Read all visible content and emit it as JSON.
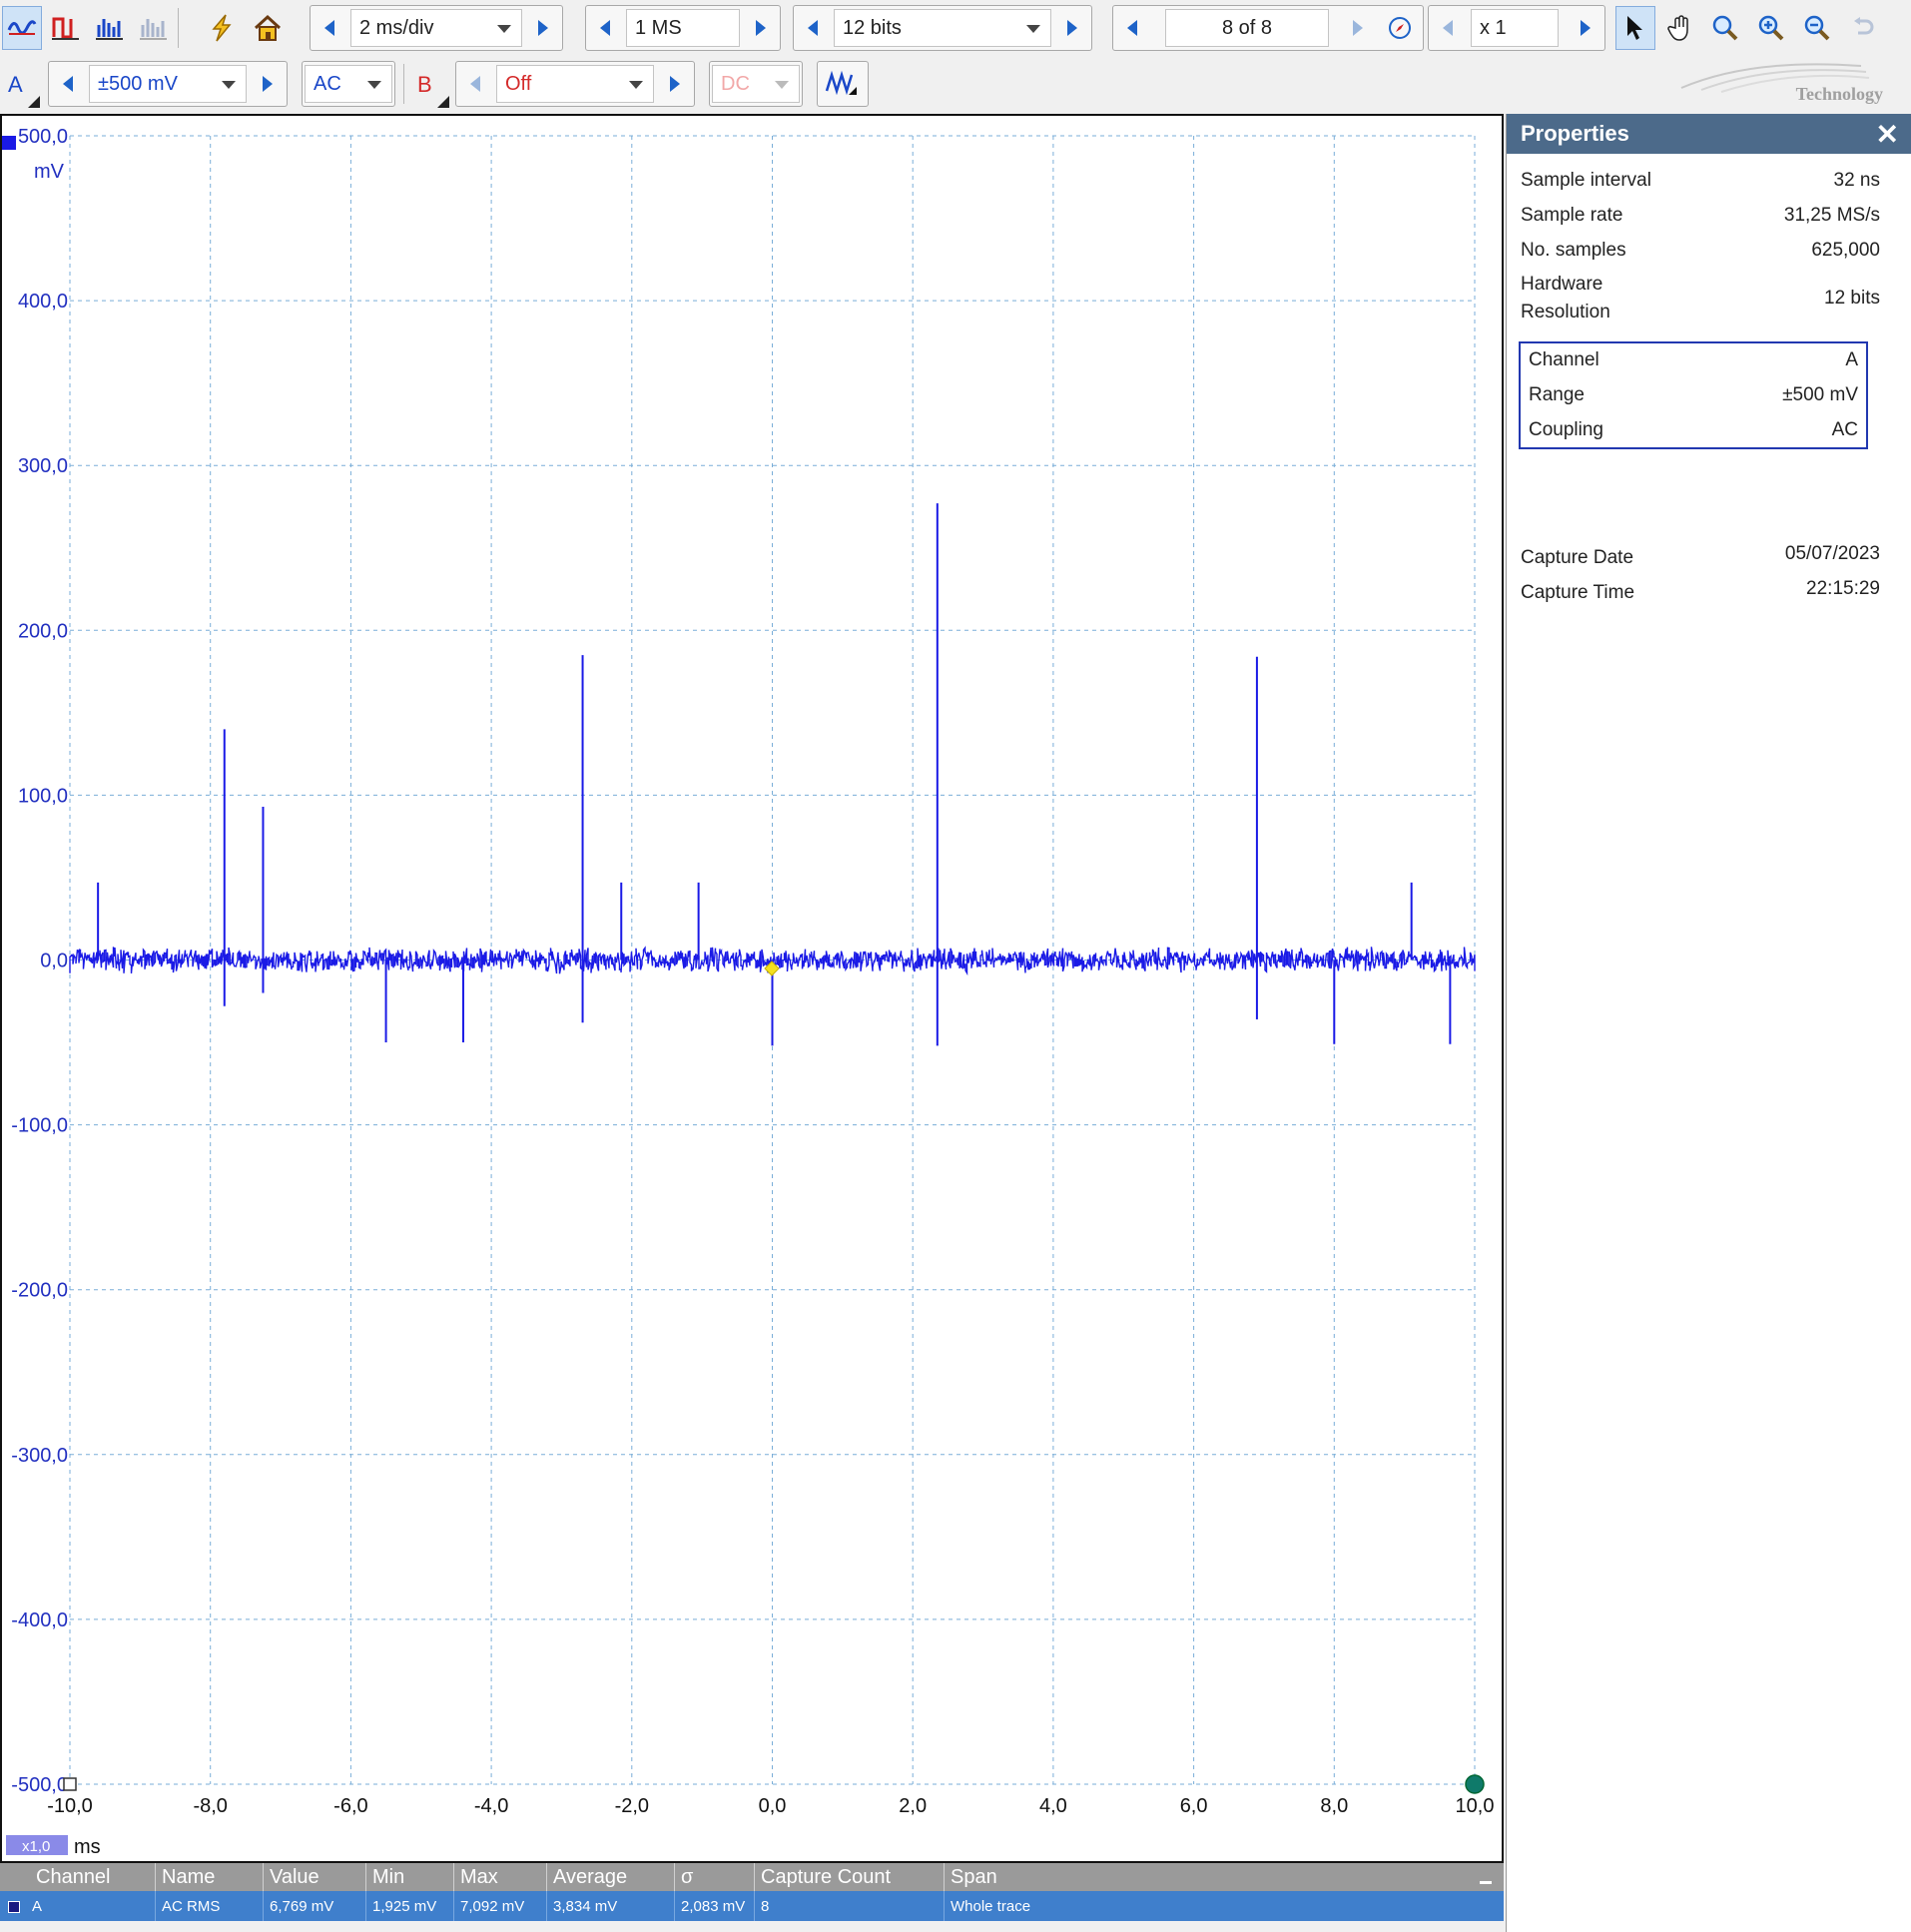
{
  "toolbar": {
    "timebase": "2 ms/div",
    "samples": "1 MS",
    "resolution": "12 bits",
    "buffer": "8 of 8",
    "zoom": "x 1"
  },
  "channel_a": {
    "label": "A",
    "range": "±500 mV",
    "coupling": "AC",
    "color": "#1a1ae6"
  },
  "channel_b": {
    "label": "B",
    "range": "Off",
    "coupling": "DC",
    "color": "#d42a2a"
  },
  "brand": "Technology",
  "scope": {
    "y_unit": "mV",
    "x_unit": "ms",
    "x_zoom_badge": "x1,0",
    "y_ticks": [
      "500,0",
      "400,0",
      "300,0",
      "200,0",
      "100,0",
      "0,0",
      "-100,0",
      "-200,0",
      "-300,0",
      "-400,0",
      "-500,0"
    ],
    "x_ticks": [
      "-10,0",
      "-8,0",
      "-6,0",
      "-4,0",
      "-2,0",
      "0,0",
      "2,0",
      "4,0",
      "6,0",
      "8,0",
      "10,0"
    ]
  },
  "chart_data": {
    "type": "line",
    "xlim": [
      -10,
      10
    ],
    "ylim": [
      -500,
      500
    ],
    "grid": true,
    "baseline_mV": 0,
    "noise_band_mV": 6,
    "spikes": [
      {
        "x": -9.6,
        "y": 47
      },
      {
        "x": -7.8,
        "y": 140
      },
      {
        "x": -7.8,
        "y": -28
      },
      {
        "x": -7.25,
        "y": 93
      },
      {
        "x": -7.25,
        "y": -20
      },
      {
        "x": -5.5,
        "y": -50
      },
      {
        "x": -4.4,
        "y": -50
      },
      {
        "x": -2.7,
        "y": 185
      },
      {
        "x": -2.7,
        "y": -38
      },
      {
        "x": -2.15,
        "y": 47
      },
      {
        "x": -1.05,
        "y": 47
      },
      {
        "x": 0.0,
        "y": -52
      },
      {
        "x": 2.35,
        "y": 277
      },
      {
        "x": 2.35,
        "y": -52
      },
      {
        "x": 6.9,
        "y": 184
      },
      {
        "x": 6.9,
        "y": -36
      },
      {
        "x": 8.0,
        "y": -51
      },
      {
        "x": 9.1,
        "y": 47
      },
      {
        "x": 9.65,
        "y": -51
      }
    ]
  },
  "measurements": {
    "headers": [
      "Channel",
      "Name",
      "Value",
      "Min",
      "Max",
      "Average",
      "σ",
      "Capture Count",
      "Span"
    ],
    "row": [
      "A",
      "AC RMS",
      "6,769 mV",
      "1,925 mV",
      "7,092 mV",
      "3,834 mV",
      "2,083 mV",
      "8",
      "Whole trace"
    ]
  },
  "properties": {
    "title": "Properties",
    "rows": [
      {
        "k": "Sample interval",
        "v": "32 ns"
      },
      {
        "k": "Sample rate",
        "v": "31,25 MS/s"
      },
      {
        "k": "No. samples",
        "v": "625,000"
      }
    ],
    "hw_res_label_1": "Hardware",
    "hw_res_label_2": "Resolution",
    "hw_res_value": "12 bits",
    "channel": [
      {
        "k": "Channel",
        "v": "A"
      },
      {
        "k": "Range",
        "v": "±500 mV"
      },
      {
        "k": "Coupling",
        "v": "AC"
      }
    ],
    "capture": [
      {
        "k": "Capture Date",
        "v": "05/07/2023"
      },
      {
        "k": "Capture Time",
        "v": "22:15:29"
      }
    ]
  }
}
